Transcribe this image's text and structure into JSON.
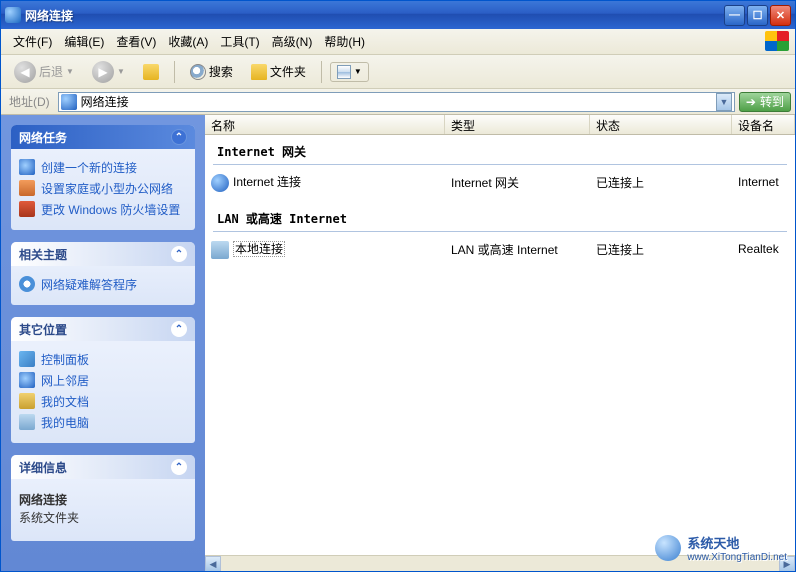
{
  "window": {
    "title": "网络连接"
  },
  "menu": {
    "file": "文件(F)",
    "edit": "编辑(E)",
    "view": "查看(V)",
    "fav": "收藏(A)",
    "tools": "工具(T)",
    "adv": "高级(N)",
    "help": "帮助(H)"
  },
  "toolbar": {
    "back": "后退",
    "search": "搜索",
    "folders": "文件夹"
  },
  "address": {
    "label": "地址(D)",
    "value": "网络连接",
    "go": "转到"
  },
  "sidebar": {
    "tasks": {
      "title": "网络任务",
      "items": [
        {
          "label": "创建一个新的连接",
          "icon": "net"
        },
        {
          "label": "设置家庭或小型办公网络",
          "icon": "home"
        },
        {
          "label": "更改 Windows 防火墙设置",
          "icon": "shield"
        }
      ]
    },
    "related": {
      "title": "相关主题",
      "items": [
        {
          "label": "网络疑难解答程序",
          "icon": "info"
        }
      ]
    },
    "other": {
      "title": "其它位置",
      "items": [
        {
          "label": "控制面板",
          "icon": "cpl"
        },
        {
          "label": "网上邻居",
          "icon": "nethood"
        },
        {
          "label": "我的文档",
          "icon": "docs"
        },
        {
          "label": "我的电脑",
          "icon": "pc"
        }
      ]
    },
    "details": {
      "title": "详细信息",
      "name": "网络连接",
      "type": "系统文件夹"
    }
  },
  "columns": {
    "name": "名称",
    "type": "类型",
    "status": "状态",
    "device": "设备名"
  },
  "groups": [
    {
      "heading": "Internet 网关",
      "items": [
        {
          "name": "Internet 连接",
          "type": "Internet 网关",
          "status": "已连接上",
          "device": "Internet",
          "icon": "globe",
          "selected": false
        }
      ]
    },
    {
      "heading": "LAN 或高速 Internet",
      "items": [
        {
          "name": "本地连接",
          "type": "LAN 或高速 Internet",
          "status": "已连接上",
          "device": "Realtek",
          "icon": "lan",
          "selected": true
        }
      ]
    }
  ],
  "watermark": {
    "line1": "系统天地",
    "line2": "www.XiTongTianDi.net"
  }
}
